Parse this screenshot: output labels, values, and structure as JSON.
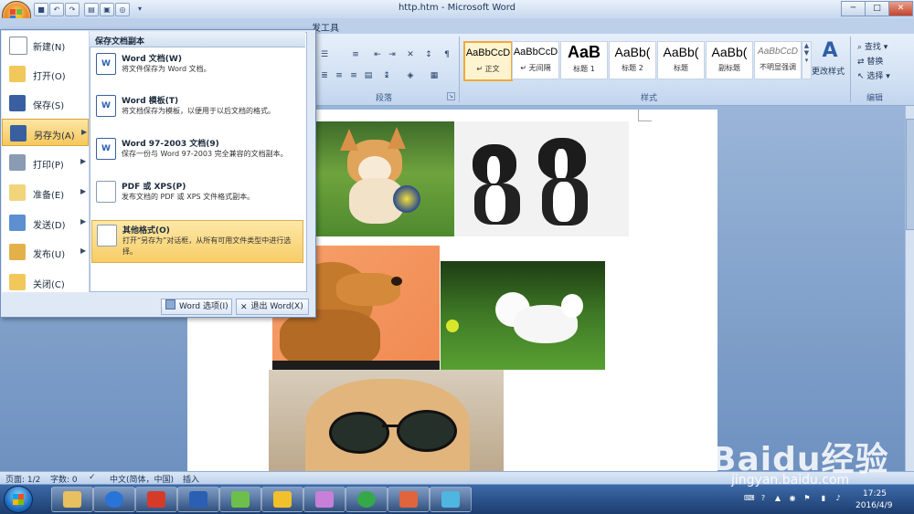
{
  "window": {
    "title": "http.htm - Microsoft Word",
    "controls": {
      "minimize": "─",
      "maximize": "□",
      "close": "✕"
    }
  },
  "quick_access": [
    "save-icon",
    "undo-icon",
    "redo-icon",
    "print-icon",
    "preview-icon",
    "customize-icon"
  ],
  "ribbon": {
    "addin_tab": "发工具",
    "groups": {
      "paragraph": "段落",
      "styles": "样式",
      "editing": "编辑"
    },
    "styles": [
      {
        "sample": "AaBbCcD",
        "name": "↵ 正文",
        "selected": true
      },
      {
        "sample": "AaBbCcD",
        "name": "↵ 无间隔"
      },
      {
        "sample": "AaB",
        "name": "标题 1"
      },
      {
        "sample": "AaBb(",
        "name": "标题 2"
      },
      {
        "sample": "AaBb(",
        "name": "标题"
      },
      {
        "sample": "AaBb(",
        "name": "副标题"
      },
      {
        "sample": "AaBbCcD",
        "name": "不明显强调"
      }
    ],
    "change_styles": "更改样式",
    "editing": {
      "find": "查找",
      "replace": "替换",
      "select": "选择"
    }
  },
  "office_menu": {
    "items": [
      {
        "label": "新建(N)",
        "arrow": false,
        "icon": "new-doc-icon"
      },
      {
        "label": "打开(O)",
        "arrow": false,
        "icon": "open-folder-icon"
      },
      {
        "label": "保存(S)",
        "arrow": false,
        "icon": "save-icon"
      },
      {
        "label": "另存为(A)",
        "arrow": true,
        "icon": "save-as-icon",
        "highlighted": true
      },
      {
        "label": "打印(P)",
        "arrow": true,
        "icon": "print-icon"
      },
      {
        "label": "准备(E)",
        "arrow": true,
        "icon": "prepare-icon"
      },
      {
        "label": "发送(D)",
        "arrow": true,
        "icon": "send-icon"
      },
      {
        "label": "发布(U)",
        "arrow": true,
        "icon": "publish-icon"
      },
      {
        "label": "关闭(C)",
        "arrow": false,
        "icon": "close-folder-icon"
      }
    ],
    "submenu": {
      "title": "保存文档副本",
      "items": [
        {
          "title": "Word 文档(W)",
          "desc": "将文件保存为 Word 文档。",
          "icon": "word-doc-icon"
        },
        {
          "title": "Word 模板(T)",
          "desc": "将文档保存为模板，以便用于以后文档的格式。",
          "icon": "word-template-icon"
        },
        {
          "title": "Word 97-2003 文档(9)",
          "desc": "保存一份与 Word 97-2003 完全兼容的文档副本。",
          "icon": "word97-doc-icon"
        },
        {
          "title": "PDF 或 XPS(P)",
          "desc": "发布文档的 PDF 或 XPS 文件格式副本。",
          "icon": "pdf-xps-icon"
        },
        {
          "title": "其他格式(O)",
          "desc": "打开“另存为”对话框，从所有可用文件类型中进行选择。",
          "icon": "other-formats-icon",
          "highlighted": true
        }
      ]
    },
    "footer": {
      "options": "Word 选项(I)",
      "exit": "退出 Word(X)"
    }
  },
  "status_bar": {
    "page": "页面: 1/2",
    "words": "字数: 0",
    "language": "中文(简体，中国)",
    "mode": "插入"
  },
  "taskbar": {
    "apps": [
      "explorer-icon",
      "sogou-icon",
      "app-360-icon",
      "word-icon",
      "paint-icon",
      "notes-icon",
      "photo-icon",
      "browser-360-icon",
      "media-icon",
      "tool-icon"
    ],
    "time": "17:25",
    "date": "2016/4/9"
  },
  "watermark": {
    "brand": "Baidu经验",
    "url": "jingyan.baidu.com"
  },
  "colors": {
    "accent": "#f6c75c",
    "ribbon": "#cfdff2",
    "taskbar": "#1c3d6e"
  }
}
